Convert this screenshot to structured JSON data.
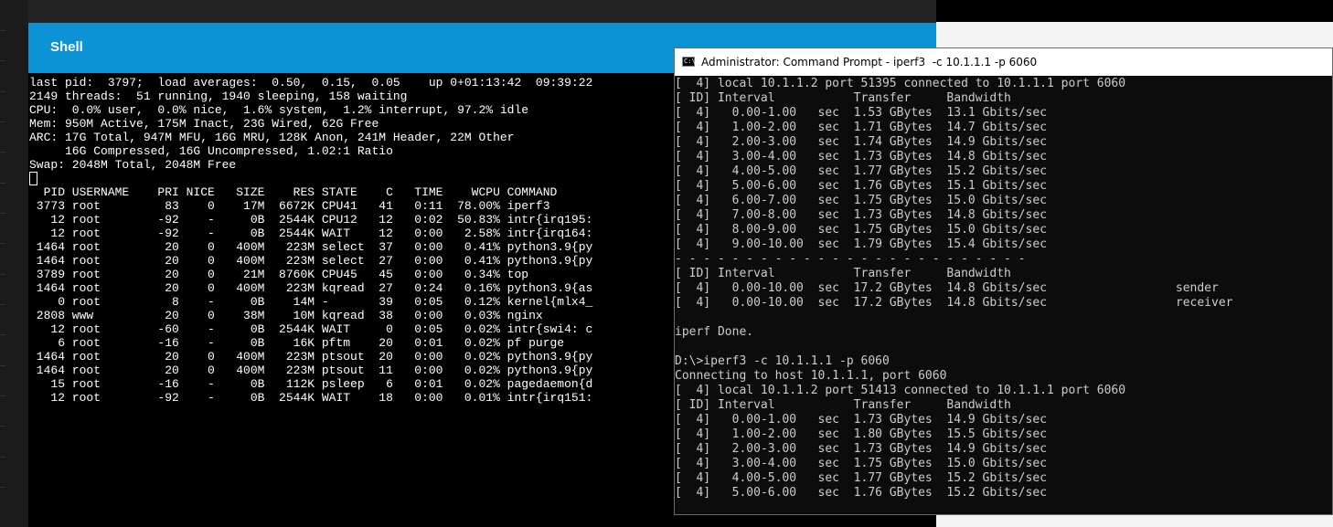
{
  "shell": {
    "title": "Shell",
    "output": "last pid:  3797;  load averages:  0.50,  0.15,  0.05    up 0+01:13:42  09:39:22\n2149 threads:  51 running, 1940 sleeping, 158 waiting\nCPU:  0.0% user,  0.0% nice,  1.6% system,  1.2% interrupt, 97.2% idle\nMem: 950M Active, 175M Inact, 23G Wired, 62G Free\nARC: 17G Total, 947M MFU, 16G MRU, 128K Anon, 241M Header, 22M Other\n     16G Compressed, 16G Uncompressed, 1.02:1 Ratio\nSwap: 2048M Total, 2048M Free\n\n  PID USERNAME    PRI NICE   SIZE    RES STATE    C   TIME    WCPU COMMAND\n 3773 root         83    0    17M  6672K CPU41   41   0:11  78.00% iperf3\n   12 root        -92    -     0B  2544K CPU12   12   0:02  50.83% intr{irq195:\n   12 root        -92    -     0B  2544K WAIT    12   0:00   2.58% intr{irq164:\n 1464 root         20    0   400M   223M select  37   0:00   0.41% python3.9{py\n 1464 root         20    0   400M   223M select  27   0:00   0.41% python3.9{py\n 3789 root         20    0    21M  8760K CPU45   45   0:00   0.34% top\n 1464 root         20    0   400M   223M kqread  27   0:24   0.16% python3.9{as\n    0 root          8    -     0B    14M -       39   0:05   0.12% kernel{mlx4_\n 2808 www          20    0    38M    10M kqread  38   0:00   0.03% nginx\n   12 root        -60    -     0B  2544K WAIT     0   0:05   0.02% intr{swi4: c\n    6 root        -16    -     0B    16K pftm    20   0:01   0.02% pf purge\n 1464 root         20    0   400M   223M ptsout  20   0:00   0.02% python3.9{py\n 1464 root         20    0   400M   223M ptsout  11   0:00   0.02% python3.9{py\n   15 root        -16    -     0B   112K psleep   6   0:01   0.02% pagedaemon{d\n   12 root        -92    -     0B  2544K WAIT    18   0:00   0.01% intr{irq151:"
  },
  "cmd": {
    "title": "Administrator: Command Prompt - iperf3  -c 10.1.1.1 -p 6060",
    "icon": "cmd-window-icon",
    "output": "[  4] local 10.1.1.2 port 51395 connected to 10.1.1.1 port 6060\n[ ID] Interval           Transfer     Bandwidth\n[  4]   0.00-1.00   sec  1.53 GBytes  13.1 Gbits/sec\n[  4]   1.00-2.00   sec  1.71 GBytes  14.7 Gbits/sec\n[  4]   2.00-3.00   sec  1.74 GBytes  14.9 Gbits/sec\n[  4]   3.00-4.00   sec  1.73 GBytes  14.8 Gbits/sec\n[  4]   4.00-5.00   sec  1.77 GBytes  15.2 Gbits/sec\n[  4]   5.00-6.00   sec  1.76 GBytes  15.1 Gbits/sec\n[  4]   6.00-7.00   sec  1.75 GBytes  15.0 Gbits/sec\n[  4]   7.00-8.00   sec  1.73 GBytes  14.8 Gbits/sec\n[  4]   8.00-9.00   sec  1.75 GBytes  15.0 Gbits/sec\n[  4]   9.00-10.00  sec  1.79 GBytes  15.4 Gbits/sec\n- - - - - - - - - - - - - - - - - - - - - - - - -\n[ ID] Interval           Transfer     Bandwidth\n[  4]   0.00-10.00  sec  17.2 GBytes  14.8 Gbits/sec                  sender\n[  4]   0.00-10.00  sec  17.2 GBytes  14.8 Gbits/sec                  receiver\n\niperf Done.\n\nD:\\>iperf3 -c 10.1.1.1 -p 6060\nConnecting to host 10.1.1.1, port 6060\n[  4] local 10.1.1.2 port 51413 connected to 10.1.1.1 port 6060\n[ ID] Interval           Transfer     Bandwidth\n[  4]   0.00-1.00   sec  1.73 GBytes  14.9 Gbits/sec\n[  4]   1.00-2.00   sec  1.80 GBytes  15.5 Gbits/sec\n[  4]   2.00-3.00   sec  1.73 GBytes  14.9 Gbits/sec\n[  4]   3.00-4.00   sec  1.75 GBytes  15.0 Gbits/sec\n[  4]   4.00-5.00   sec  1.77 GBytes  15.2 Gbits/sec\n[  4]   5.00-6.00   sec  1.76 GBytes  15.2 Gbits/sec"
  },
  "colors": {
    "shell_header": "#0b93d5",
    "terminal_bg": "#000000",
    "cmd_text": "#cccccc"
  }
}
